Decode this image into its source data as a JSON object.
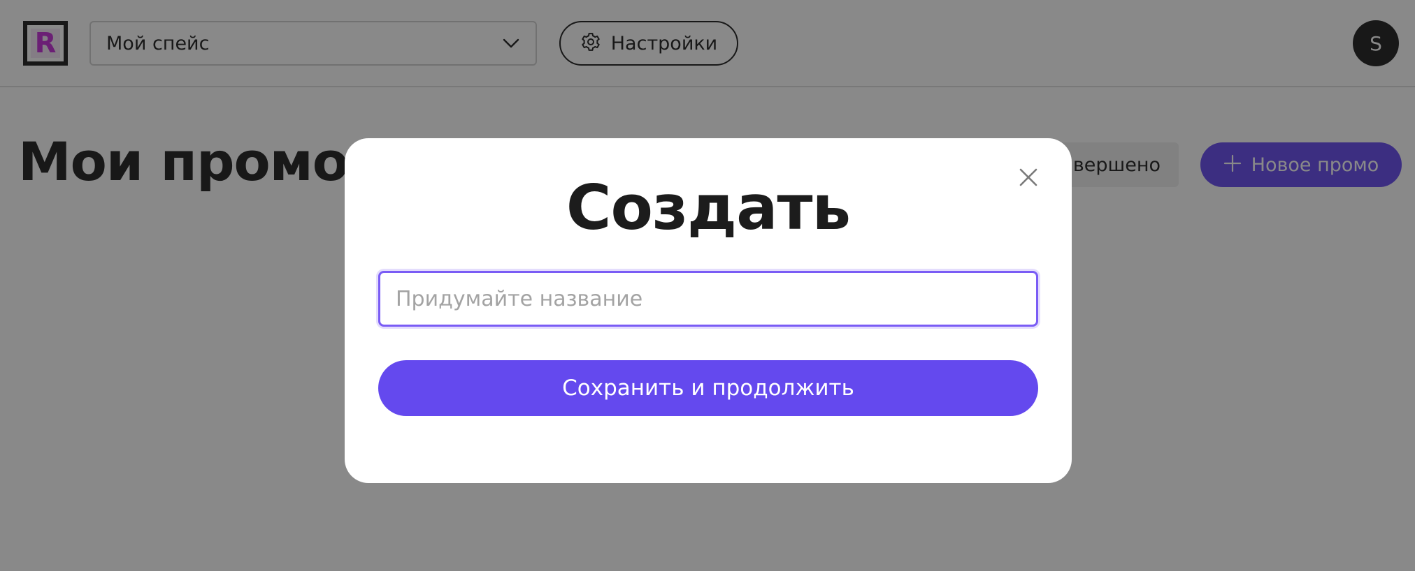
{
  "header": {
    "logo_letter": "R",
    "space_select": {
      "value": "Мой спейс"
    },
    "settings_label": "Настройки",
    "avatar_initial": "S"
  },
  "page": {
    "title": "Мои промо",
    "filter_chip_label": "Завершено",
    "new_promo_label": "Новое промо"
  },
  "modal": {
    "title": "Создать",
    "name_input": {
      "value": "",
      "placeholder": "Придумайте название"
    },
    "save_label": "Сохранить и продолжить"
  },
  "colors": {
    "accent": "#6449ee",
    "logo_accent": "#c32ad6",
    "text": "#1c1c1c",
    "overlay": "rgba(20,20,20,0.5)"
  },
  "icons": {
    "dropdown": "chevron-down-icon",
    "settings": "gear-icon",
    "new_promo": "plus-icon",
    "close": "close-icon"
  }
}
